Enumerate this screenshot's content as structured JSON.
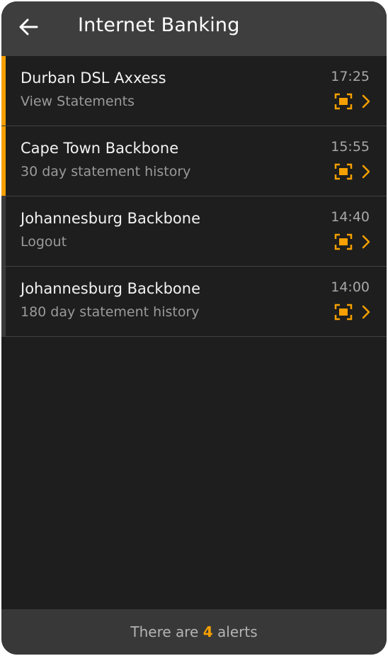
{
  "header": {
    "title": "Internet Banking",
    "back_icon": "arrow-left-icon"
  },
  "colors": {
    "accent": "#f5a000",
    "background": "#1e1e1e",
    "header": "#3e3e3e"
  },
  "alerts": [
    {
      "title": "Durban DSL Axxess",
      "subtitle": "View Statements",
      "time": "17:25",
      "highlighted": true
    },
    {
      "title": "Cape Town Backbone",
      "subtitle": "30 day statement history",
      "time": "15:55",
      "highlighted": true
    },
    {
      "title": "Johannesburg Backbone",
      "subtitle": "Logout",
      "time": "14:40",
      "highlighted": false
    },
    {
      "title": "Johannesburg Backbone",
      "subtitle": "180 day statement history",
      "time": "14:00",
      "highlighted": false
    }
  ],
  "footer": {
    "prefix": "There are",
    "count": "4",
    "suffix": "alerts"
  }
}
